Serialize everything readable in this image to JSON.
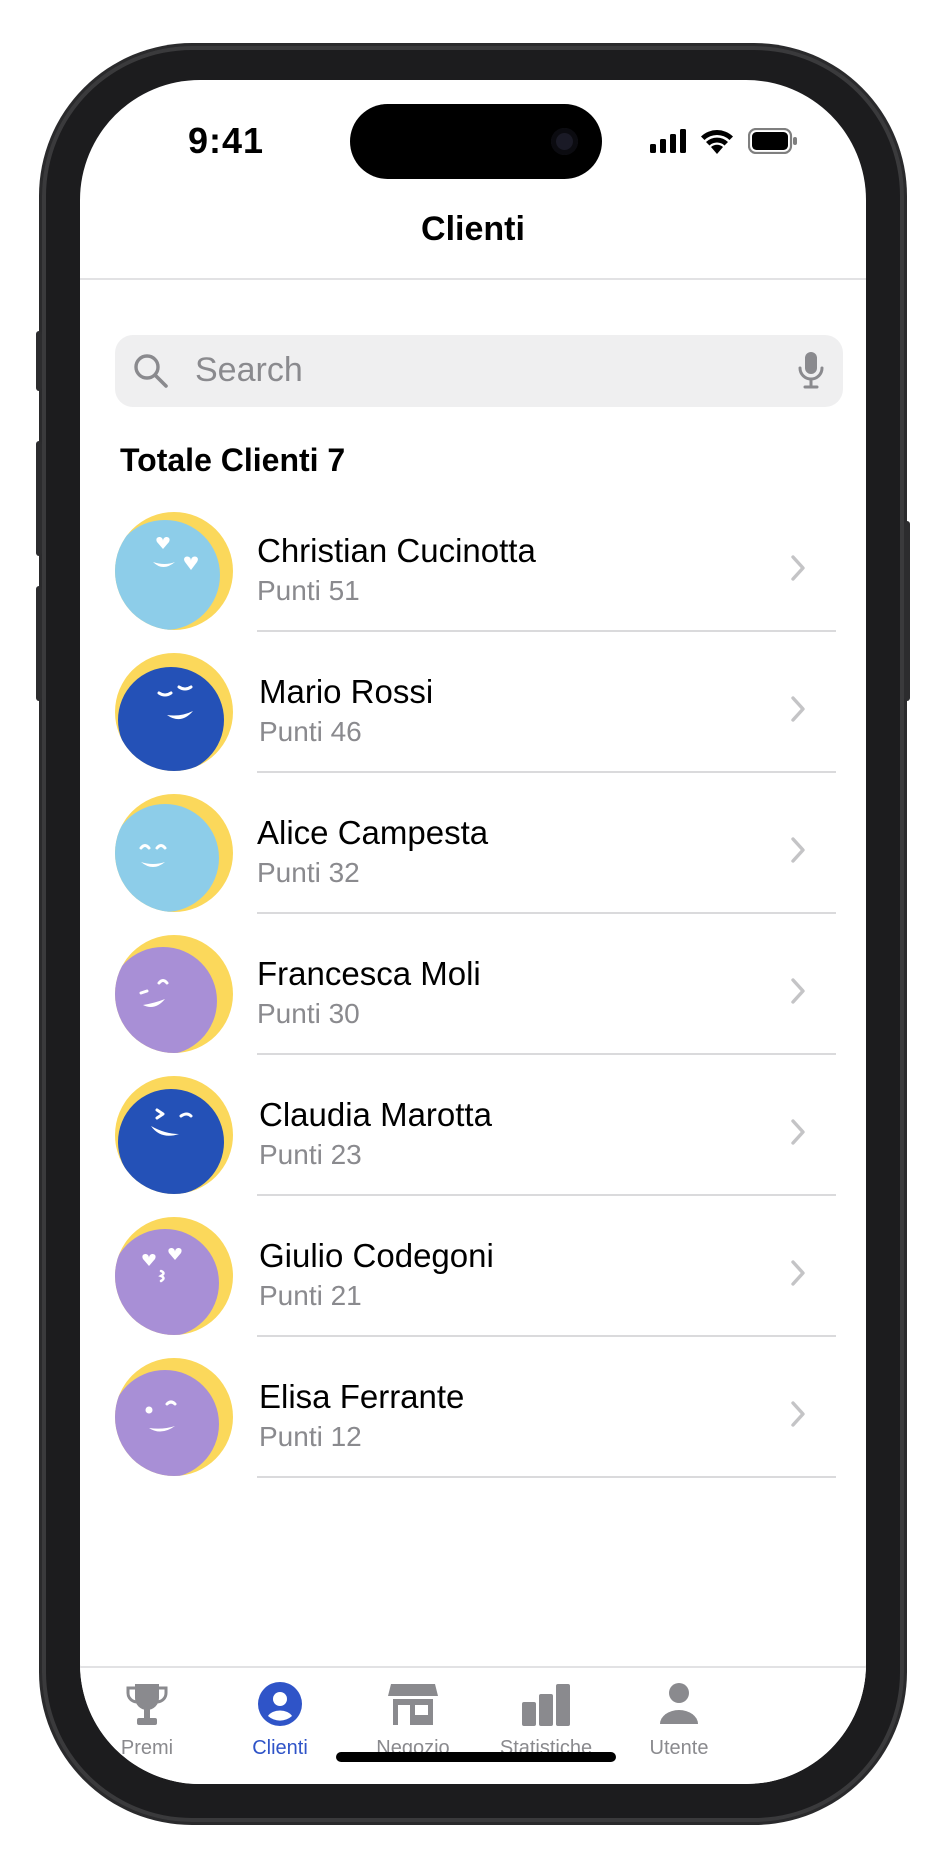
{
  "status_bar": {
    "time": "9:41"
  },
  "nav": {
    "title": "Clienti"
  },
  "search": {
    "placeholder": "Search",
    "value": ""
  },
  "summary": {
    "label": "Totale Clienti 7"
  },
  "clients": [
    {
      "name": "Christian Cucinotta",
      "points": "Punti 51",
      "avatar_color": "#8dcde9",
      "expression": "heart-eyes-wink"
    },
    {
      "name": "Mario Rossi",
      "points": "Punti 46",
      "avatar_color": "#2451b7",
      "expression": "sleepy-smile"
    },
    {
      "name": "Alice Campesta",
      "points": "Punti 32",
      "avatar_color": "#8dcde9",
      "expression": "happy-smile"
    },
    {
      "name": "Francesca Moli",
      "points": "Punti 30",
      "avatar_color": "#a88fd6",
      "expression": "wink"
    },
    {
      "name": "Claudia Marotta",
      "points": "Punti 23",
      "avatar_color": "#2451b7",
      "expression": "laugh-wink"
    },
    {
      "name": "Giulio Codegoni",
      "points": "Punti 21",
      "avatar_color": "#a88fd6",
      "expression": "kiss-heart"
    },
    {
      "name": "Elisa Ferrante",
      "points": "Punti 12",
      "avatar_color": "#a88fd6",
      "expression": "smile"
    }
  ],
  "tabs": [
    {
      "label": "Premi",
      "icon": "trophy-icon",
      "active": false
    },
    {
      "label": "Clienti",
      "icon": "person-circle-icon",
      "active": true
    },
    {
      "label": "Negozio",
      "icon": "storefront-icon",
      "active": false
    },
    {
      "label": "Statistiche",
      "icon": "bar-chart-icon",
      "active": false
    },
    {
      "label": "Utente",
      "icon": "person-icon",
      "active": false
    }
  ],
  "colors": {
    "accent": "#2f54c8",
    "avatar_background": "#fbd85b",
    "secondary_text": "#8a8a8e"
  }
}
